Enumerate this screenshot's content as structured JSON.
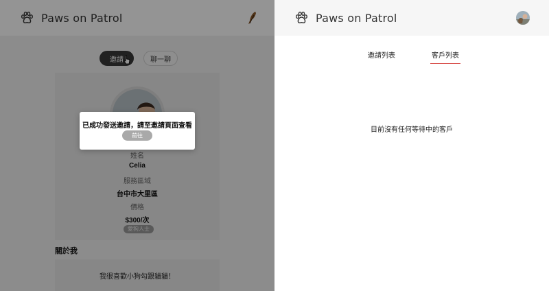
{
  "left": {
    "app_title": "Paws on Patrol",
    "buttons": {
      "invite": "邀請",
      "chat": "聊一聊"
    },
    "profile": {
      "name_label": "姓名",
      "name_value": "Celia",
      "area_label": "服務區域",
      "area_value": "台中市大里區",
      "price_label": "價格",
      "price_value": "$300/次",
      "tag": "愛狗人士"
    },
    "about": {
      "heading": "關於我",
      "text": "我很喜歡小狗勾跟貓貓！"
    },
    "dialog": {
      "message": "已成功發送邀請，請至邀請頁面查看",
      "button": "前往"
    }
  },
  "right": {
    "app_title": "Paws on Patrol",
    "tabs": {
      "invites": "邀請列表",
      "clients": "客戶列表"
    },
    "empty_message": "目前沒有任何等待中的客戶"
  },
  "colors": {
    "accent_underline": "#d9534f",
    "dark_button": "#3a3a3a",
    "overlay": "rgba(0,0,0,0.42)"
  },
  "icons": [
    "paw-icon",
    "feather-icon",
    "cursor-icon",
    "user-avatar"
  ]
}
